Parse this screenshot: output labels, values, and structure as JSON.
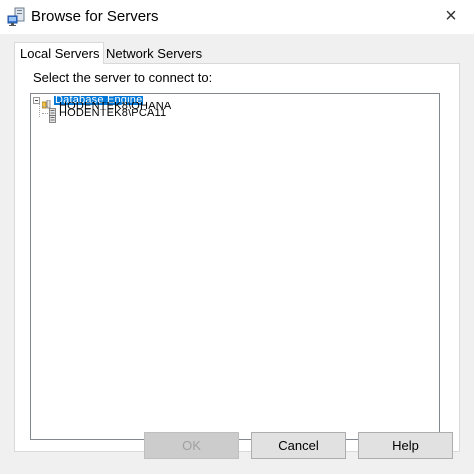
{
  "window": {
    "title": "Browse for Servers",
    "close_glyph": "×",
    "app_icon": "server-network-icon"
  },
  "tabs": [
    {
      "label": "Local Servers",
      "selected": true
    },
    {
      "label": "Network Servers",
      "selected": false
    }
  ],
  "panel": {
    "prompt": "Select the server to connect to:"
  },
  "tree": {
    "root": {
      "label": "Database Engine",
      "expanded": true,
      "selected": true,
      "icon": "database-engine-icon"
    },
    "children": [
      {
        "label": "HODENTEK8\\OHANA",
        "icon": "server-icon"
      },
      {
        "label": "HODENTEK8\\PCA11",
        "icon": "server-icon"
      }
    ]
  },
  "buttons": {
    "ok": "OK",
    "cancel": "Cancel",
    "help": "Help"
  },
  "colors": {
    "selection": "#0078d7",
    "dialog_bg": "#f0f0f0"
  }
}
